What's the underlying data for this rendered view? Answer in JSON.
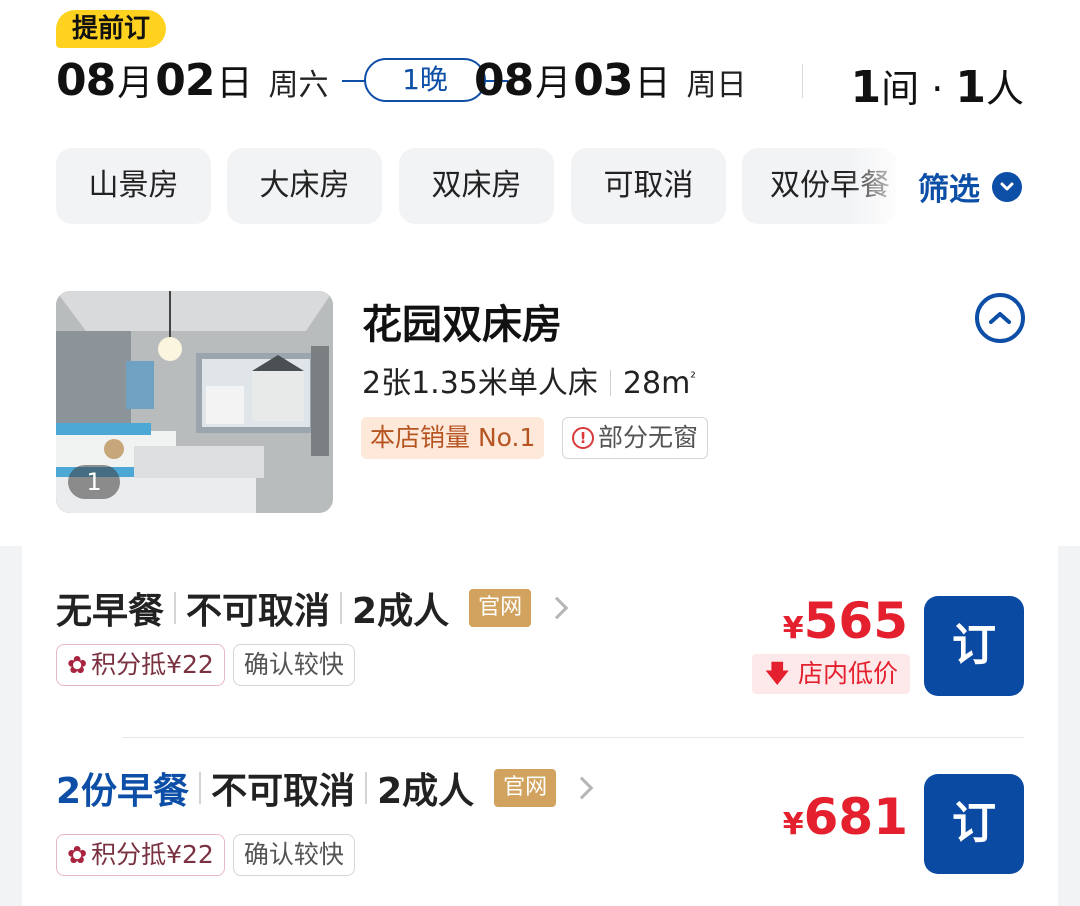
{
  "header": {
    "advance_badge": "提前订",
    "checkin": {
      "month": "08",
      "month_unit": "月",
      "day": "02",
      "day_unit": "日",
      "weekday": "周六"
    },
    "nights": "1晚",
    "checkout": {
      "month": "08",
      "month_unit": "月",
      "day": "03",
      "day_unit": "日",
      "weekday": "周日"
    },
    "rooms": "1",
    "rooms_unit": "间",
    "separator": " · ",
    "guests": "1",
    "guests_unit": "人"
  },
  "filters": {
    "chips": [
      "山景房",
      "大床房",
      "双床房",
      "可取消",
      "双份早餐"
    ],
    "filter_label": "筛选"
  },
  "room": {
    "title": "花园双床房",
    "beds": "2张1.35米单人床",
    "area": "28m",
    "area_sup": "²",
    "photo_count": "1",
    "tags": {
      "sales": "本店销量 No.1",
      "window": "部分无窗"
    },
    "icons": {
      "collapse": "chevron-up-icon",
      "window_warning": "alert-circle-icon"
    }
  },
  "rates": [
    {
      "meal": "无早餐",
      "cancel": "不可取消",
      "occupancy": "2成人",
      "official": "官网",
      "points": "积分抵¥22",
      "confirm": "确认较快",
      "currency": "¥",
      "price": "565",
      "low_price_badge": "店内低价",
      "book": "订"
    },
    {
      "meal": "2份早餐",
      "cancel": "不可取消",
      "occupancy": "2成人",
      "official": "官网",
      "points": "积分抵¥22",
      "confirm": "确认较快",
      "currency": "¥",
      "price": "681",
      "book": "订"
    }
  ],
  "colors": {
    "brand_blue": "#0d4ea6",
    "price_red": "#e5202e",
    "badge_yellow": "#ffd21f",
    "official_gold": "#d2a35e"
  }
}
